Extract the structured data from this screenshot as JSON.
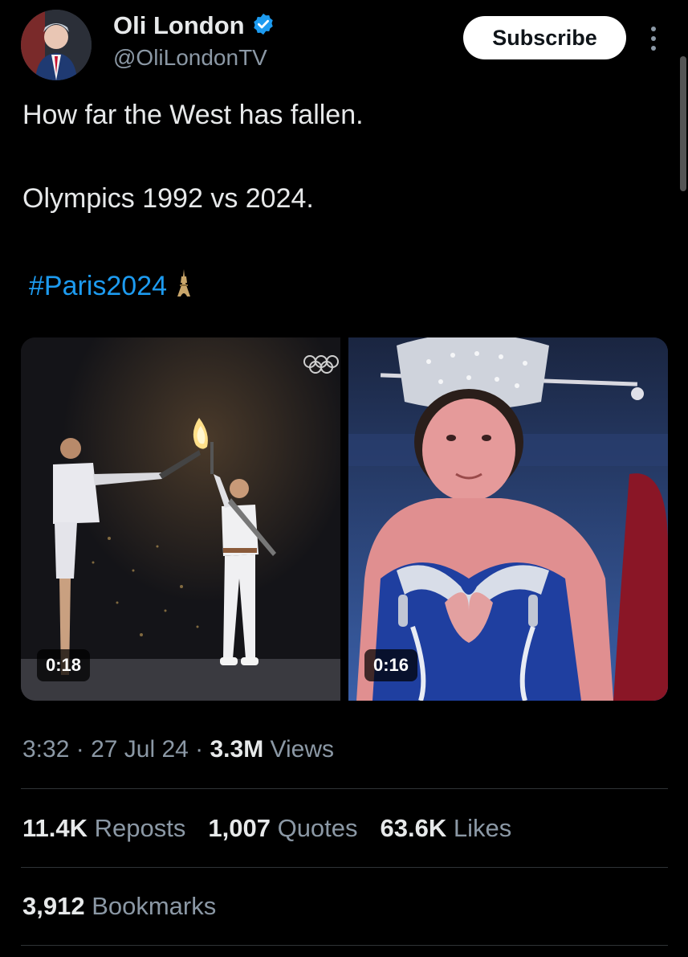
{
  "author": {
    "display_name": "Oli London",
    "handle": "@OliLondonTV",
    "verified": true
  },
  "actions": {
    "subscribe_label": "Subscribe"
  },
  "tweet": {
    "line1": "How far the West has fallen.",
    "line2": "Olympics 1992 vs 2024.",
    "hashtag": "#Paris2024"
  },
  "media": [
    {
      "duration": "0:18"
    },
    {
      "duration": "0:16"
    }
  ],
  "meta": {
    "time": "3:32",
    "date": "27 Jul 24",
    "views_count": "3.3M",
    "views_label": "Views"
  },
  "stats": {
    "reposts_count": "11.4K",
    "reposts_label": "Reposts",
    "quotes_count": "1,007",
    "quotes_label": "Quotes",
    "likes_count": "63.6K",
    "likes_label": "Likes",
    "bookmarks_count": "3,912",
    "bookmarks_label": "Bookmarks"
  },
  "colors": {
    "background": "#000000",
    "accent": "#1d9bf0",
    "text": "#e7e9ea",
    "muted": "#8b98a5"
  }
}
